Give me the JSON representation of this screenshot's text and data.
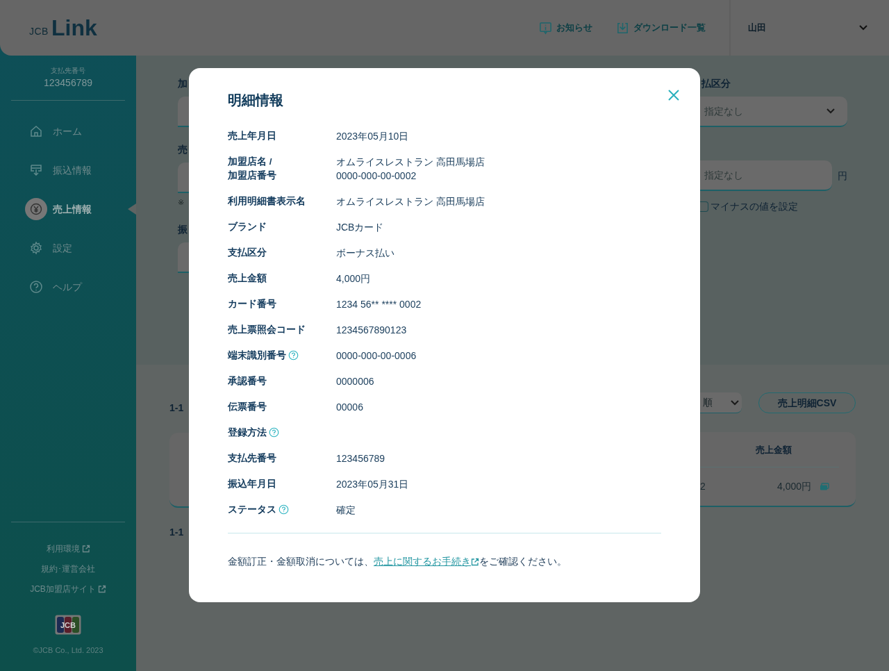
{
  "header": {
    "logo": {
      "prefix": "JCB",
      "name": "Link"
    },
    "links": [
      {
        "label": "お知らせ",
        "kind": "info"
      },
      {
        "label": "ダウンロード一覧",
        "kind": "download"
      }
    ],
    "user": "山田"
  },
  "sidebar": {
    "account_label": "支払先番号",
    "account_number": "123456789",
    "items": [
      {
        "label": "ホーム",
        "kind": "home",
        "selected": false
      },
      {
        "label": "振込情報",
        "kind": "transfer",
        "selected": false
      },
      {
        "label": "売上情報",
        "kind": "yen",
        "selected": true
      },
      {
        "label": "設定",
        "kind": "gear",
        "selected": false
      },
      {
        "label": "ヘルプ",
        "kind": "help",
        "selected": false
      }
    ],
    "links": [
      {
        "label": "利用環境",
        "external": true
      },
      {
        "label": "規約･運営会社",
        "external": false
      },
      {
        "label": "JCB加盟店サイト",
        "external": true
      }
    ],
    "brand_mark": "JCB",
    "copyright": "©JCB Co., Ltd. 2023"
  },
  "search_form": {
    "left_fields": [
      {
        "label": "加"
      },
      {
        "label": "売",
        "note": "※"
      },
      {
        "label": "振"
      }
    ],
    "payment_type": {
      "label": "払区分",
      "value": "指定なし"
    },
    "amount": {
      "placeholder": "指定なし",
      "unit": "円"
    },
    "negative": {
      "label": "マイナスの値を設定",
      "checked": false
    }
  },
  "results": {
    "count_top": "1-1",
    "sort": {
      "value": "順"
    },
    "csv_button": "売上明細CSV",
    "table": {
      "columns": [
        "売上金額"
      ],
      "rows": [
        {
          "cells": [
            "2",
            "4,000円"
          ]
        }
      ]
    },
    "count_bottom": "1-1"
  },
  "modal": {
    "title": "明細情報",
    "rows": [
      {
        "label": "売上年月日",
        "value": "2023年05月10日",
        "help": false
      },
      {
        "label": "加盟店名 /\n加盟店番号",
        "value": "オムライスレストラン 高田馬場店\n0000-000-00-0002",
        "help": false
      },
      {
        "label": "利用明細書表示名",
        "value": "オムライスレストラン 高田馬場店",
        "help": false
      },
      {
        "label": "ブランド",
        "value": "JCBカード",
        "help": false
      },
      {
        "label": "支払区分",
        "value": "ボーナス払い",
        "help": false
      },
      {
        "label": "売上金額",
        "value": "4,000円",
        "help": false
      },
      {
        "label": "カード番号",
        "value": "1234 56** **** 0002",
        "help": false
      },
      {
        "label": "売上票照会コード",
        "value": "1234567890123",
        "help": false
      },
      {
        "label": "端末識別番号",
        "value": "0000-000-00-0006",
        "help": true
      },
      {
        "label": "承認番号",
        "value": "0000006",
        "help": false
      },
      {
        "label": "伝票番号",
        "value": "00006",
        "help": false
      },
      {
        "label": "登録方法",
        "help": true
      },
      {
        "label": "支払先番号",
        "value": "123456789",
        "help": false
      },
      {
        "label": "振込年月日",
        "value": "2023年05月31日",
        "help": false
      },
      {
        "label": "ステータス",
        "value": "確定",
        "help": true
      }
    ],
    "note": {
      "before": "金額訂正・金額取消については、",
      "link": "売上に関するお手続き",
      "after": "をご確認ください。"
    }
  }
}
